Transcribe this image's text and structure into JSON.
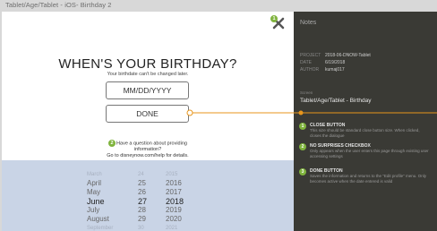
{
  "page_title": "Tablet/Age/Tablet - iOS- Birthday 2",
  "screen": {
    "heading": "WHEN'S YOUR BIRTHDAY?",
    "subtext": "Your birthdate can't be changed later.",
    "date_input": {
      "placeholder": "MM/DD/YYYY"
    },
    "done_label": "DONE",
    "help_line1": "Have a question about providing",
    "help_line2": "information?",
    "help_line3": "Go to disneynow.com/help for details.",
    "close_badge": "1",
    "help_badge": "2"
  },
  "picker": {
    "months": [
      "March",
      "April",
      "May",
      "June",
      "July",
      "August",
      "September"
    ],
    "days": [
      "24",
      "25",
      "26",
      "27",
      "28",
      "29",
      "30"
    ],
    "years": [
      "2015",
      "2016",
      "2017",
      "2018",
      "2019",
      "2020",
      "2021"
    ],
    "selected_index": 3
  },
  "notes": {
    "title": "Notes",
    "meta": [
      {
        "key": "Project",
        "value": "2018-06-DNOW-Tablet"
      },
      {
        "key": "Date",
        "value": "6/19/2018"
      },
      {
        "key": "Author",
        "value": "kumaj017"
      }
    ],
    "section_label": "Screen",
    "section_value": "Tablet/Age/Tablet - Birthday",
    "items": [
      {
        "num": "1",
        "title": "CLOSE BUTTON",
        "desc": "This size should be standard close button size. When clicked, closes the dialogue"
      },
      {
        "num": "2",
        "title": "NO SURPRISES CHECKBOX",
        "desc": "Only appears when the user enters this page through existing user accessing settings"
      },
      {
        "num": "3",
        "title": "DONE BUTTON",
        "desc": "Saves the information and returns to the \"Edit profile\" menu. Only becomes active when the date entered is valid"
      }
    ]
  },
  "colors": {
    "accent": "#7fb33d",
    "connector": "#e8961c",
    "panel": "#3a3a35",
    "picker": "#c9d4e6"
  }
}
